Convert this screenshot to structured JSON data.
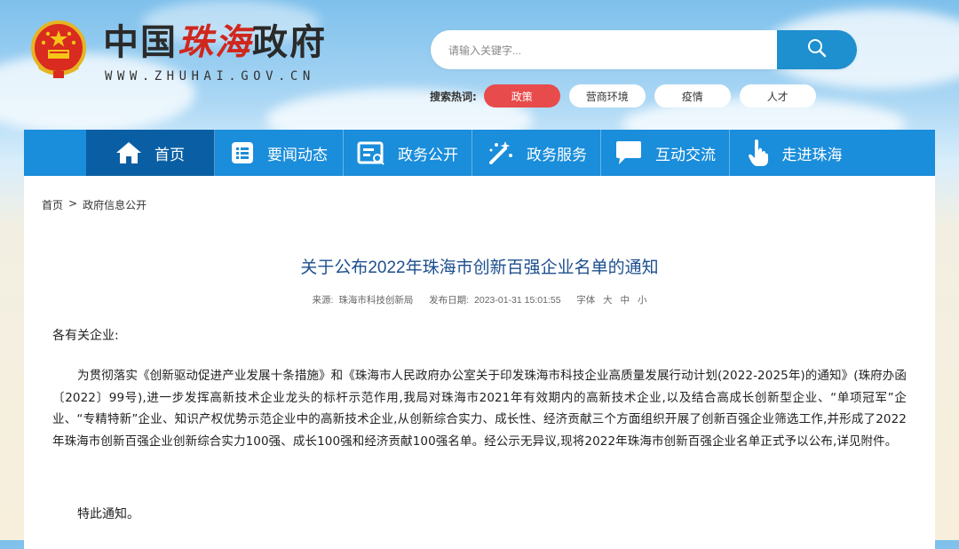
{
  "header": {
    "title_part1": "中国",
    "title_part2": "珠海",
    "title_part3": "政府",
    "domain": "WWW.ZHUHAI.GOV.CN"
  },
  "search": {
    "placeholder": "请输入关键字..."
  },
  "hot": {
    "label": "搜索热词:",
    "tags": [
      "政策",
      "营商环境",
      "疫情",
      "人才"
    ]
  },
  "nav": {
    "items": [
      "首页",
      "要闻动态",
      "政务公开",
      "政务服务",
      "互动交流",
      "走进珠海"
    ]
  },
  "breadcrumb": {
    "items": [
      "首页",
      ">",
      "政府信息公开"
    ]
  },
  "article": {
    "title": "关于公布2022年珠海市创新百强企业名单的通知",
    "source_label": "来源:",
    "source": "珠海市科技创新局",
    "date_label": "发布日期:",
    "date": "2023-01-31 15:01:55",
    "font_label": "字体",
    "font_large": "大",
    "font_medium": "中",
    "font_small": "小",
    "salutation": "各有关企业:",
    "paragraph": "为贯彻落实《创新驱动促进产业发展十条措施》和《珠海市人民政府办公室关于印发珠海市科技企业高质量发展行动计划(2022-2025年)的通知》(珠府办函〔2022〕99号),进一步发挥高新技术企业龙头的标杆示范作用,我局对珠海市2021年有效期内的高新技术企业,以及结合高成长创新型企业、“单项冠军”企业、“专精特新”企业、知识产权优势示范企业中的高新技术企业,从创新综合实力、成长性、经济贡献三个方面组织开展了创新百强企业筛选工作,并形成了2022年珠海市创新百强企业创新综合实力100强、成长100强和经济贡献100强名单。经公示无异议,现将2022年珠海市创新百强企业名单正式予以公布,详见附件。",
    "closing": "特此通知。"
  },
  "colors": {
    "nav": "#1a8ddb",
    "nav_active": "#0a5fa4",
    "hot_active": "#e84b4b",
    "title": "#1d4f8f"
  }
}
